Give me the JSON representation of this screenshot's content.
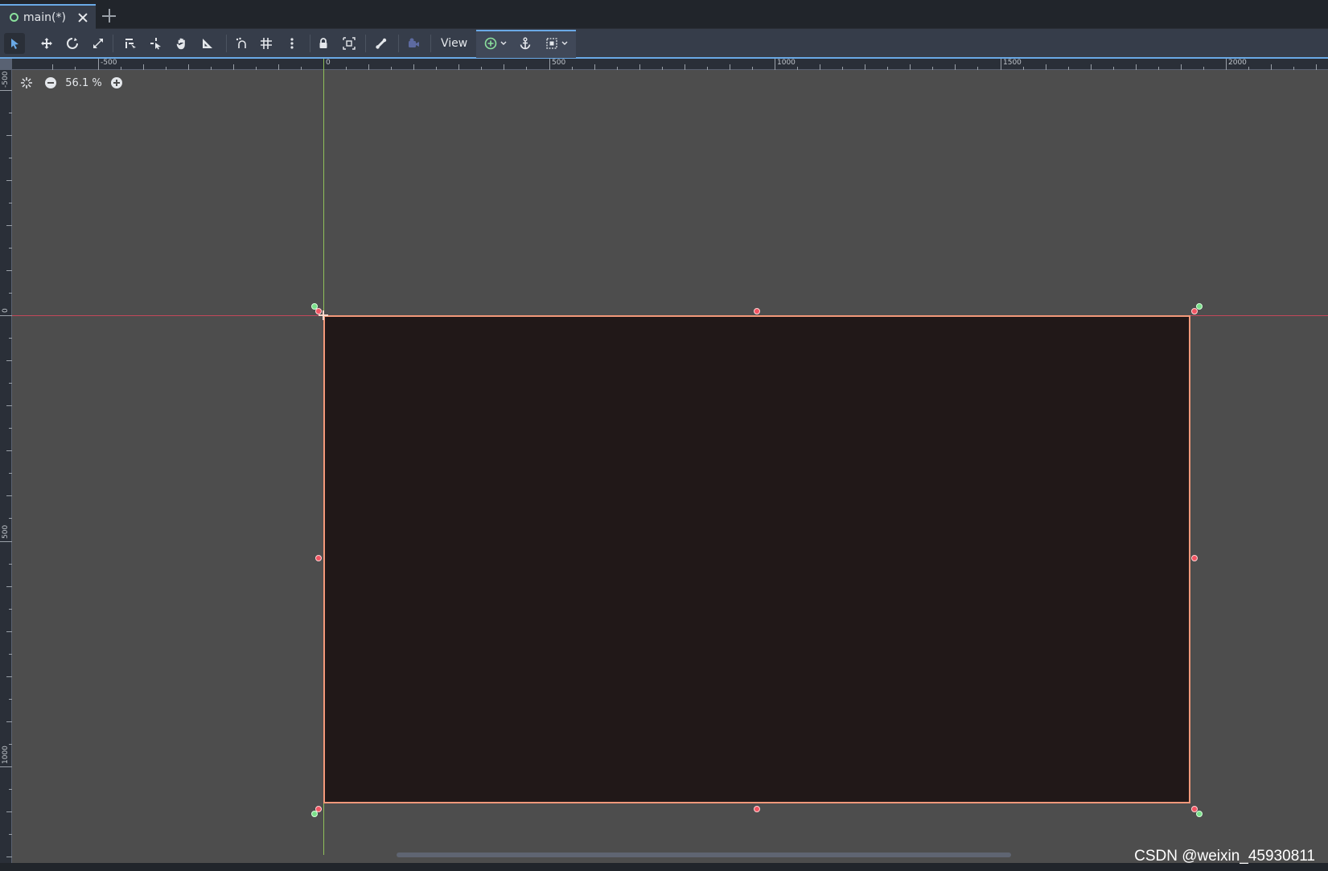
{
  "tab": {
    "label": "main(*)"
  },
  "toolbar": {
    "view_label": "View",
    "buttons": [
      "select-icon",
      "move-icon",
      "rotate-icon",
      "scale-icon",
      "list-select-icon",
      "pivot-icon",
      "pan-icon",
      "ruler-icon",
      "smart-snap-icon",
      "grid-snap-icon",
      "more-icon",
      "lock-icon",
      "group-icon",
      "skeleton-icon",
      "camera-icon",
      "add-icon",
      "anchor-icon",
      "layout-icon"
    ]
  },
  "zoom": {
    "value": "56.1 %"
  },
  "rulers": {
    "horizontal_labels": [
      "-500",
      "0",
      "500",
      "1000",
      "1500",
      "2000"
    ],
    "vertical_labels": [
      "-500",
      "0",
      "500",
      "1000"
    ]
  },
  "colors": {
    "accent": "#6aa9e6",
    "rect_fill": "#211818",
    "rect_border": "#f2987a",
    "axis_x": "#c2485a",
    "axis_y": "#8fbf5a",
    "viewport_bg": "#4d4d4d"
  },
  "watermark": "CSDN @weixin_45930811"
}
